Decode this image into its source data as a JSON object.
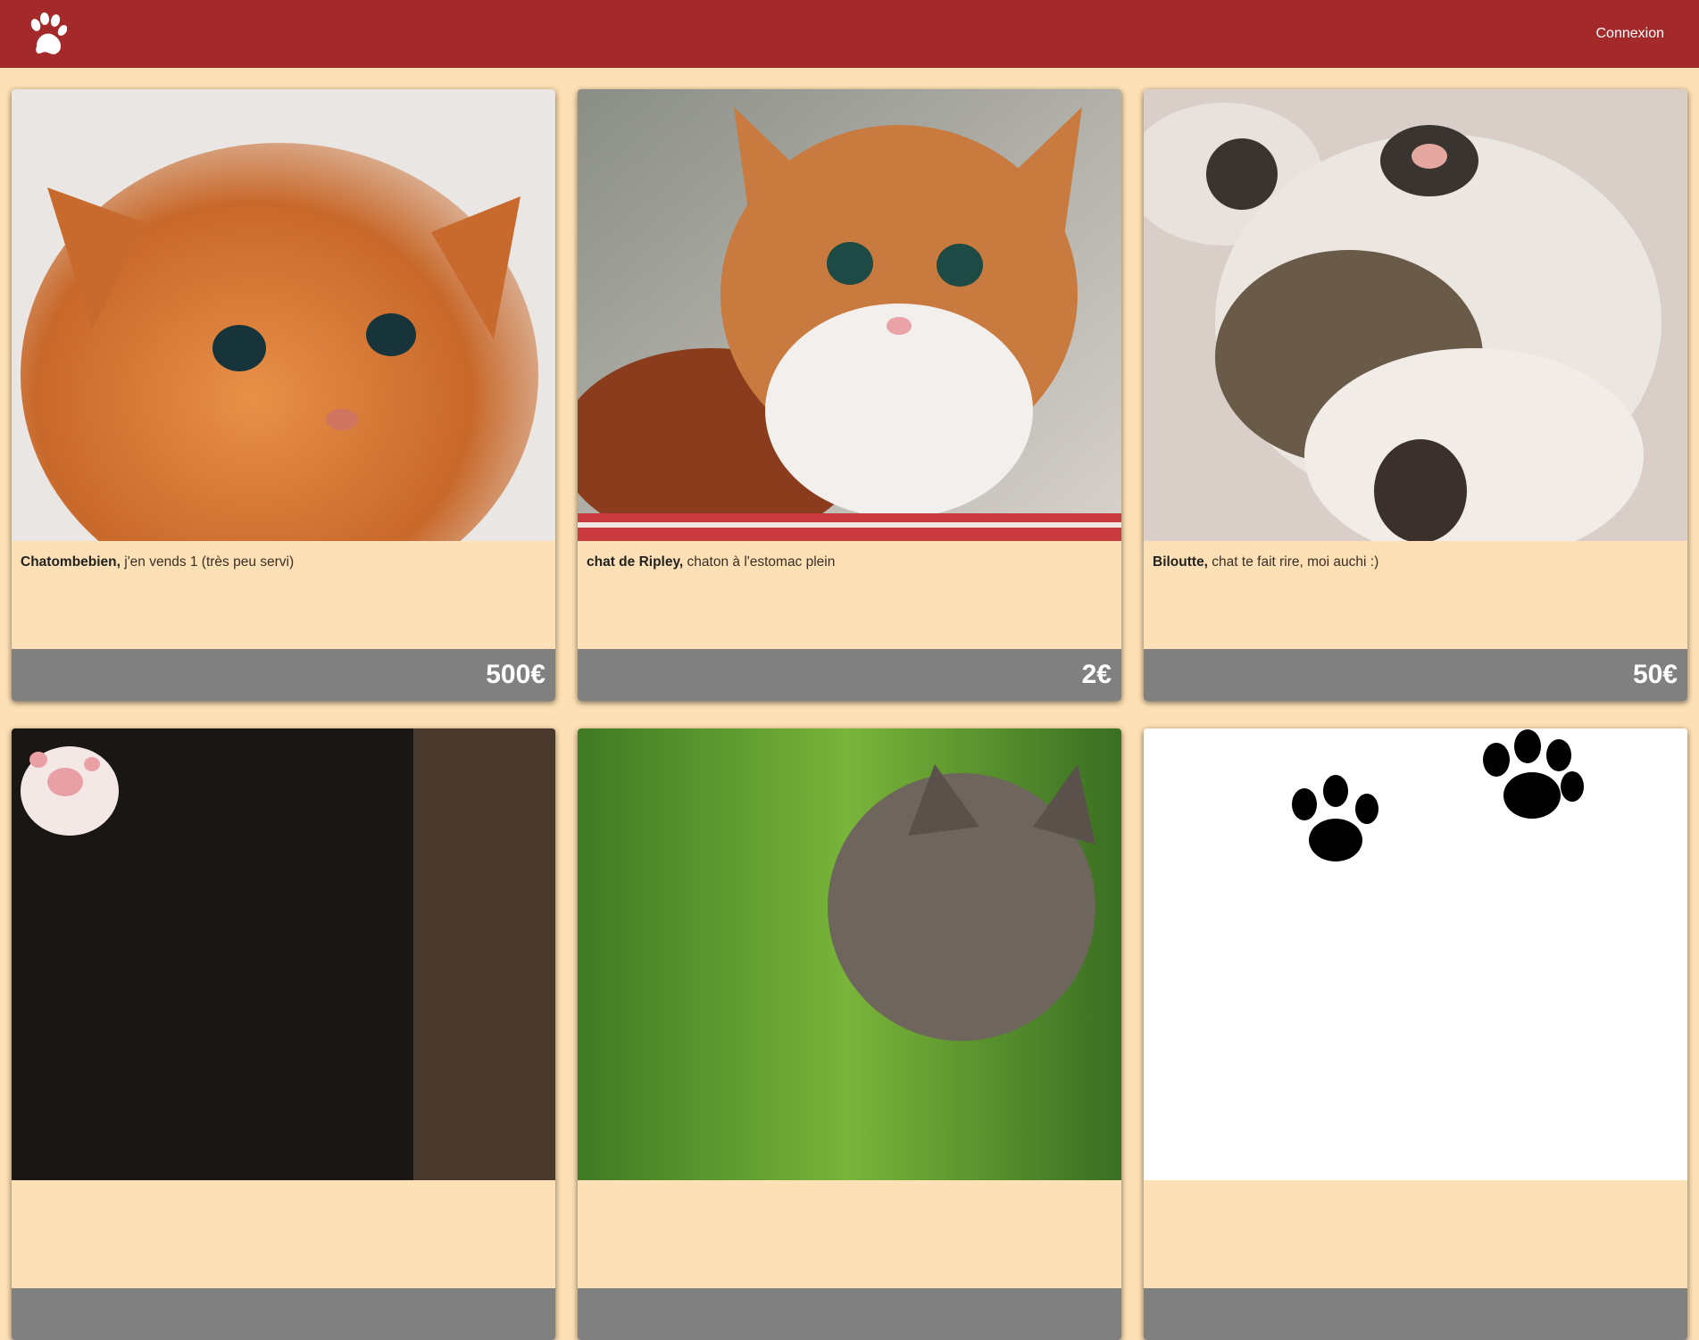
{
  "header": {
    "logo_icon": "paw-icon",
    "login_label": "Connexion",
    "bg_color": "#a3292a"
  },
  "listings": [
    {
      "name": "Chatombebien,",
      "description": " j'en vends 1 (très peu servi)",
      "price": "500€",
      "photo": "orange-kitten-photo"
    },
    {
      "name": "chat de Ripley,",
      "description": " chaton à l'estomac plein",
      "price": "2€",
      "photo": "ginger-white-kitten-photo"
    },
    {
      "name": "Biloutte,",
      "description": " chat te fait rire, moi auchi :)",
      "price": "50€",
      "photo": "sleeping-tabby-kitten-photo"
    },
    {
      "name": "",
      "description": "",
      "price": "",
      "photo": "kitten-paw-dark-photo"
    },
    {
      "name": "",
      "description": "",
      "price": "",
      "photo": "tabby-kitten-green-photo"
    },
    {
      "name": "",
      "description": "",
      "price": "",
      "photo": "black-paw-prints-photo"
    }
  ],
  "colors": {
    "page_bg": "#fde0b5",
    "price_bar": "#808080"
  }
}
